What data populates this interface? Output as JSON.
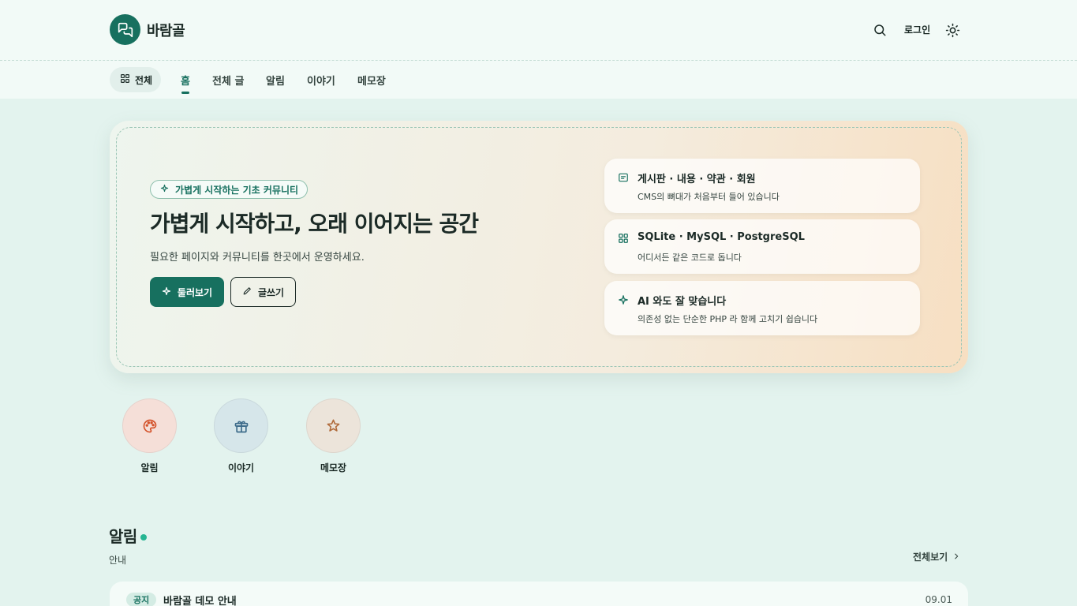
{
  "header": {
    "brand": "바람골",
    "login_label": "로그인",
    "icons": {
      "logo": "chat-bubbles-icon",
      "search": "search-icon",
      "theme": "sun-icon"
    }
  },
  "nav": {
    "all_label": "전체",
    "items": [
      {
        "label": "홈",
        "active": true
      },
      {
        "label": "전체 글",
        "active": false
      },
      {
        "label": "알림",
        "active": false
      },
      {
        "label": "이야기",
        "active": false
      },
      {
        "label": "메모장",
        "active": false
      }
    ]
  },
  "hero": {
    "badge": "가볍게 시작하는 기초 커뮤니티",
    "title": "가볍게 시작하고, 오래 이어지는 공간",
    "subtitle": "필요한 페이지와 커뮤니티를 한곳에서 운영하세요.",
    "primary_button": "둘러보기",
    "secondary_button": "글쓰기",
    "features": [
      {
        "icon": "board-icon",
        "title": "게시판 · 내용 · 약관 · 회원",
        "desc": "CMS의 뼈대가 처음부터 들어 있습니다"
      },
      {
        "icon": "grid-icon",
        "title": "SQLite · MySQL · PostgreSQL",
        "desc": "어디서든 같은 코드로 돕니다"
      },
      {
        "icon": "sparkle-icon",
        "title": "AI 와도 잘 맞습니다",
        "desc": "의존성 없는 단순한 PHP 라 함께 고치기 쉽습니다"
      }
    ]
  },
  "quick_links": [
    {
      "label": "알림",
      "icon": "palette-icon",
      "bg": "#f5dfd8",
      "color": "#d4532b"
    },
    {
      "label": "이야기",
      "icon": "gift-icon",
      "bg": "#d6e6ea",
      "color": "#3d6b8a"
    },
    {
      "label": "메모장",
      "icon": "star-icon",
      "bg": "#ece4da",
      "color": "#b06a3a"
    }
  ],
  "section": {
    "title": "알림",
    "subtitle": "안내",
    "see_all": "전체보기"
  },
  "posts": [
    {
      "badge": "공지",
      "title": "바람골 데모 안내",
      "date": "09.01"
    }
  ],
  "colors": {
    "accent": "#17705f",
    "background": "#e3f3ee",
    "dot": "#25b592"
  }
}
